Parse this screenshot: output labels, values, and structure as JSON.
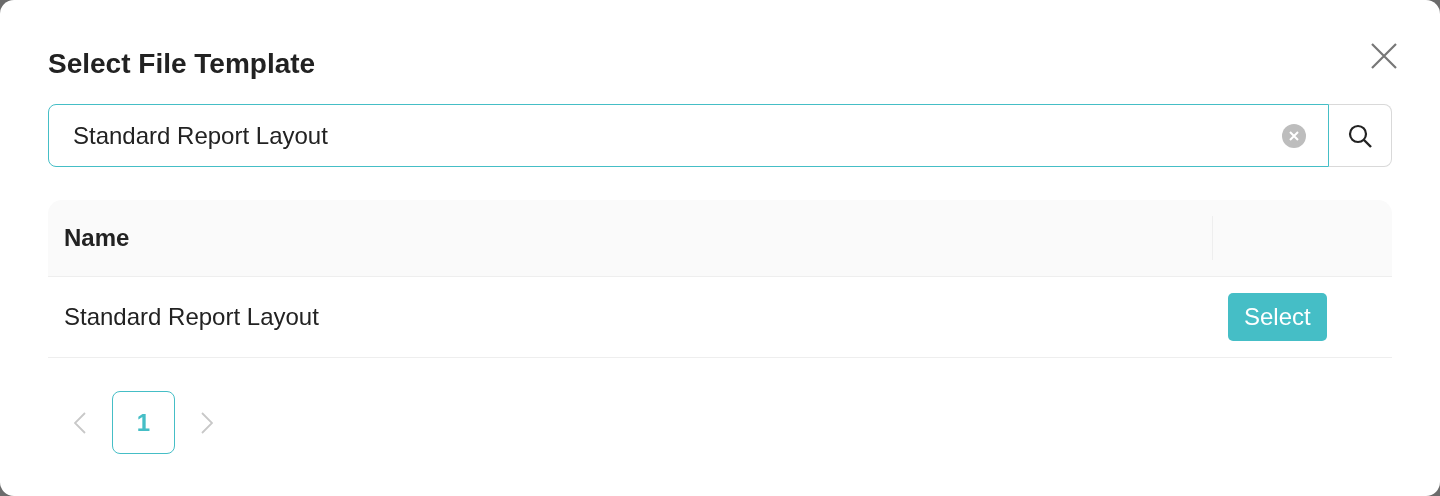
{
  "dialog": {
    "title": "Select File Template"
  },
  "search": {
    "value": "Standard Report Layout"
  },
  "table": {
    "columns": [
      "Name"
    ],
    "rows": [
      {
        "name": "Standard Report Layout",
        "action": "Select"
      }
    ]
  },
  "pagination": {
    "prev": {
      "disabled": true
    },
    "pages": [
      {
        "label": "1",
        "selected": true
      }
    ],
    "next": {
      "disabled": true
    }
  }
}
